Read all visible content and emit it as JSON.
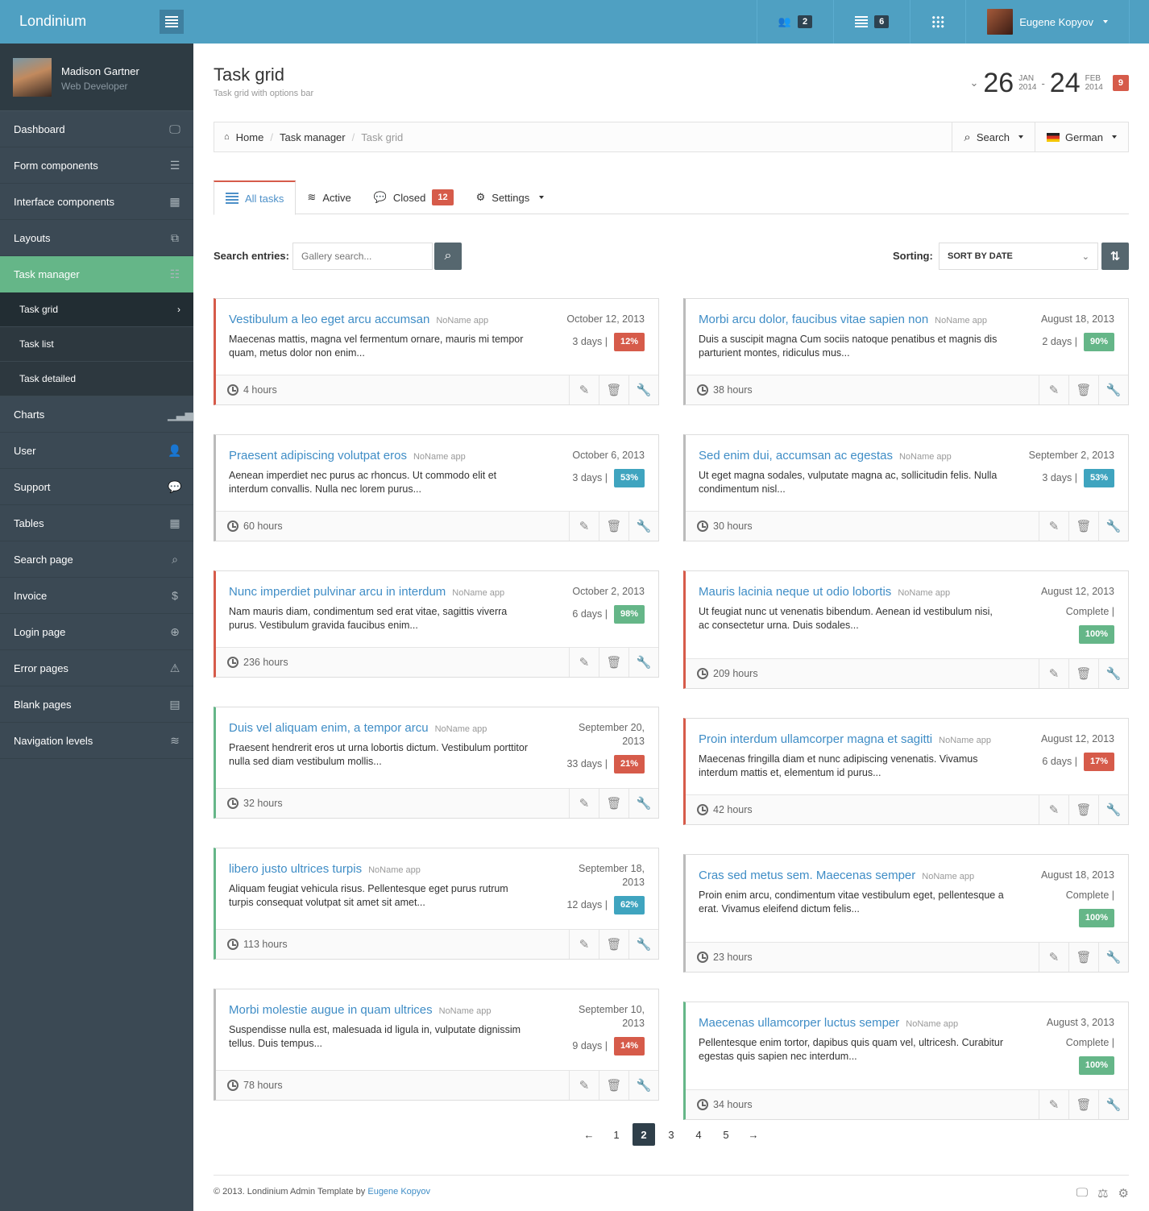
{
  "app": {
    "title": "Londinium",
    "toggle_icon": "sidebar-toggle-icon"
  },
  "topnav": {
    "users_count": "2",
    "list_count": "6",
    "user_name": "Eugene Kopyov"
  },
  "profile": {
    "name": "Madison Gartner",
    "role": "Web Developer"
  },
  "sidebar": {
    "items": [
      {
        "label": "Dashboard",
        "icon": "🖵"
      },
      {
        "label": "Form components",
        "icon": "☰"
      },
      {
        "label": "Interface components",
        "icon": "▦"
      },
      {
        "label": "Layouts",
        "icon": "⧉"
      },
      {
        "label": "Task manager",
        "icon": "☷"
      },
      {
        "label": "Charts",
        "icon": "▁▃▅"
      },
      {
        "label": "User",
        "icon": "👤"
      },
      {
        "label": "Support",
        "icon": "💬"
      },
      {
        "label": "Tables",
        "icon": "▦"
      },
      {
        "label": "Search page",
        "icon": "⌕"
      },
      {
        "label": "Invoice",
        "icon": "$"
      },
      {
        "label": "Login page",
        "icon": "⊕"
      },
      {
        "label": "Error pages",
        "icon": "⚠"
      },
      {
        "label": "Blank pages",
        "icon": "▤"
      },
      {
        "label": "Navigation levels",
        "icon": "≋"
      }
    ],
    "sub_items": [
      {
        "label": "Task grid",
        "icon": "›"
      },
      {
        "label": "Task list"
      },
      {
        "label": "Task detailed"
      }
    ]
  },
  "page": {
    "title": "Task grid",
    "subtitle": "Task grid with options bar"
  },
  "daterange": {
    "from_day": "26",
    "from_month": "JAN",
    "from_year": "2014",
    "sep": "-",
    "to_day": "24",
    "to_month": "FEB",
    "to_year": "2014",
    "badge": "9"
  },
  "breadcrumb": {
    "items": [
      "Home",
      "Task manager",
      "Task grid"
    ],
    "sep": "/",
    "search_label": "Search",
    "language": "German"
  },
  "tabs": [
    {
      "label": "All tasks"
    },
    {
      "label": "Active"
    },
    {
      "label": "Closed",
      "badge": "12"
    },
    {
      "label": "Settings"
    }
  ],
  "search": {
    "label": "Search entries:",
    "placeholder": "Gallery search...",
    "sort_label": "Sorting:",
    "sort_value": "SORT BY DATE"
  },
  "colors": {
    "red": "#d65b4a",
    "green": "#65b688",
    "blue": "#3fa4bf",
    "accent": "#4fa0c2"
  },
  "tasks_left": [
    {
      "title": "Vestibulum a leo eget arcu accumsan",
      "app": "NoName app",
      "desc": "Maecenas mattis, magna vel fermentum ornare, mauris mi tempor quam, metus dolor non enim...",
      "date": "October 12, 2013",
      "duration": "3 days |",
      "percent": "12%",
      "status": "red",
      "border": "red",
      "hours": "4 hours"
    },
    {
      "title": "Praesent adipiscing volutpat eros",
      "app": "NoName app",
      "desc": "Aenean imperdiet nec purus ac rhoncus. Ut commodo elit et interdum convallis. Nulla nec lorem purus...",
      "date": "October 6, 2013",
      "duration": "3 days |",
      "percent": "53%",
      "status": "blue",
      "border": "gray",
      "hours": "60 hours"
    },
    {
      "title": "Nunc imperdiet pulvinar arcu in interdum",
      "app": "NoName app",
      "desc": "Nam mauris diam, condimentum sed erat vitae, sagittis viverra purus. Vestibulum gravida faucibus enim...",
      "date": "October 2, 2013",
      "duration": "6 days |",
      "percent": "98%",
      "status": "green",
      "border": "red",
      "hours": "236 hours"
    },
    {
      "title": "Duis vel aliquam enim, a tempor arcu",
      "app": "NoName app",
      "desc": "Praesent hendrerit eros ut urna lobortis dictum. Vestibulum porttitor nulla sed diam vestibulum mollis...",
      "date": "September 20, 2013",
      "duration": "33 days |",
      "percent": "21%",
      "status": "red",
      "border": "green",
      "hours": "32 hours"
    },
    {
      "title": "libero justo ultrices turpis",
      "app": "NoName app",
      "desc": "Aliquam feugiat vehicula risus. Pellentesque eget purus rutrum turpis consequat volutpat sit amet sit amet...",
      "date": "September 18, 2013",
      "duration": "12 days |",
      "percent": "62%",
      "status": "blue",
      "border": "green",
      "hours": "113 hours"
    },
    {
      "title": "Morbi molestie augue in quam ultrices",
      "app": "NoName app",
      "desc": "Suspendisse nulla est, malesuada id ligula in, vulputate dignissim tellus. Duis tempus...",
      "date": "September 10, 2013",
      "duration": "9 days |",
      "percent": "14%",
      "status": "red",
      "border": "gray",
      "hours": "78 hours"
    }
  ],
  "tasks_right": [
    {
      "title": "Morbi arcu dolor, faucibus vitae sapien non",
      "app": "NoName app",
      "desc": "Duis a suscipit magna Cum sociis natoque penatibus et magnis dis parturient montes, ridiculus mus...",
      "date": "August 18, 2013",
      "duration": "2 days |",
      "percent": "90%",
      "status": "green",
      "border": "gray",
      "hours": "38 hours"
    },
    {
      "title": "Sed enim dui, accumsan ac egestas",
      "app": "NoName app",
      "desc": "Ut eget magna sodales, vulputate magna ac, sollicitudin felis. Nulla condimentum nisl...",
      "date": "September 2, 2013",
      "duration": "3 days |",
      "percent": "53%",
      "status": "blue",
      "border": "gray",
      "hours": "30 hours"
    },
    {
      "title": "Mauris lacinia neque ut odio lobortis",
      "app": "NoName app",
      "desc": "Ut feugiat nunc ut venenatis bibendum. Aenean id vestibulum nisi, ac consectetur urna. Duis sodales...",
      "date": "August 12, 2013",
      "duration": "Complete |",
      "percent": "100%",
      "status": "green",
      "border": "red",
      "hours": "209 hours"
    },
    {
      "title": "Proin interdum ullamcorper magna et sagitti",
      "app": "NoName app",
      "desc": "Maecenas fringilla diam et nunc adipiscing venenatis. Vivamus interdum mattis et, elementum id purus...",
      "date": "August 12, 2013",
      "duration": "6 days |",
      "percent": "17%",
      "status": "red",
      "border": "red",
      "hours": "42 hours"
    },
    {
      "title": "Cras sed metus sem. Maecenas semper",
      "app": "NoName app",
      "desc": "Proin enim arcu, condimentum vitae vestibulum eget, pellentesque a erat. Vivamus eleifend dictum felis...",
      "date": "August 18, 2013",
      "duration": "Complete |",
      "percent": "100%",
      "status": "green",
      "border": "gray",
      "hours": "23 hours"
    },
    {
      "title": "Maecenas ullamcorper luctus semper",
      "app": "NoName app",
      "desc": "Pellentesque enim tortor, dapibus quis quam vel, ultricesh. Curabitur egestas quis sapien nec interdum...",
      "date": "August 3, 2013",
      "duration": "Complete |",
      "percent": "100%",
      "status": "green",
      "border": "green",
      "hours": "34 hours"
    }
  ],
  "pagination": {
    "prev": "←",
    "pages": [
      "1",
      "2",
      "3",
      "4",
      "5"
    ],
    "current": "2",
    "next": "→"
  },
  "footer": {
    "text": "© 2013. Londinium Admin Template by ",
    "author": "Eugene Kopyov"
  }
}
